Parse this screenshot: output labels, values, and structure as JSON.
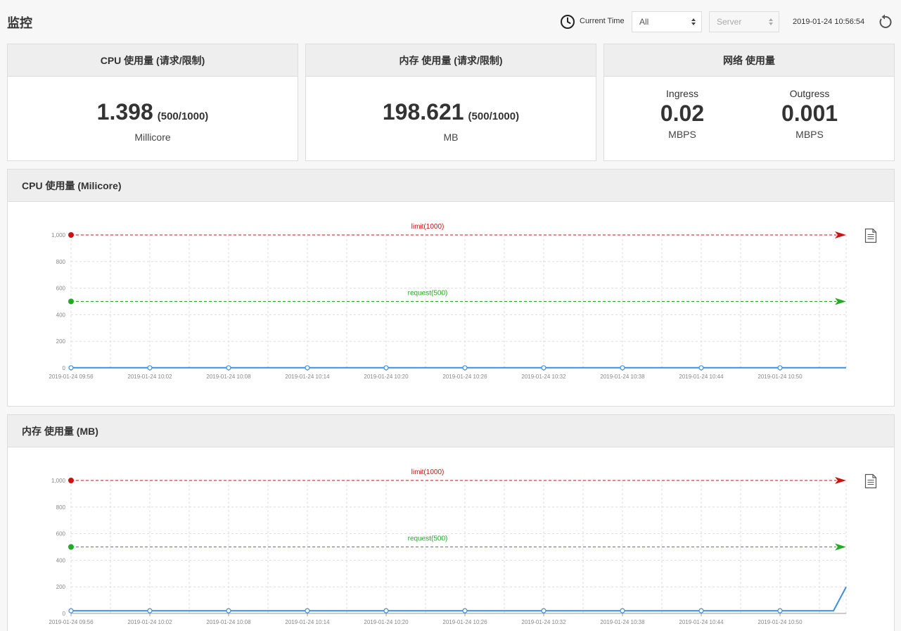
{
  "header": {
    "title": "监控",
    "time_label": "Current Time",
    "range_select": "All",
    "server_select": "Server",
    "timestamp": "2019-01-24 10:56:54"
  },
  "stats": {
    "cpu": {
      "title": "CPU 使用量 (请求/限制)",
      "value": "1.398",
      "ratio": "(500/1000)",
      "unit": "Millicore"
    },
    "memory": {
      "title": "内存 使用量 (请求/限制)",
      "value": "198.621",
      "ratio": "(500/1000)",
      "unit": "MB"
    },
    "network": {
      "title": "网络 使用量",
      "ingress": {
        "label": "Ingress",
        "value": "0.02",
        "unit": "MBPS"
      },
      "outgress": {
        "label": "Outgress",
        "value": "0.001",
        "unit": "MBPS"
      }
    }
  },
  "colors": {
    "limit": "#cc1111",
    "request": "#22aa22",
    "series": "#3a8ee6"
  },
  "chart_data": [
    {
      "type": "line",
      "title": "CPU 使用量 (Milicore)",
      "x": [
        "2019-01-24 09:56",
        "2019-01-24 10:02",
        "2019-01-24 10:08",
        "2019-01-24 10:14",
        "2019-01-24 10:20",
        "2019-01-24 10:26",
        "2019-01-24 10:32",
        "2019-01-24 10:38",
        "2019-01-24 10:44",
        "2019-01-24 10:50"
      ],
      "xticks": [
        "2019-01-24 09:56",
        "2019-01-24 10:02",
        "2019-01-24 10:08",
        "2019-01-24 10:14",
        "2019-01-24 10:20",
        "2019-01-24 10:26",
        "2019-01-24 10:32",
        "2019-01-24 10:38",
        "2019-01-24 10:44",
        "2019-01-24 10:50"
      ],
      "series": [
        {
          "values": [
            1,
            1,
            1,
            1,
            1,
            1,
            1,
            1,
            1,
            1
          ],
          "tail": [
            1,
            1
          ]
        }
      ],
      "ylim": [
        0,
        1000
      ],
      "yticks": [
        0,
        200,
        400,
        600,
        800,
        1000
      ],
      "ytick_labels": [
        "0",
        "200",
        "400",
        "600",
        "800",
        "1,000"
      ],
      "thresholds": [
        {
          "label": "limit(1000)",
          "value": 1000,
          "kind": "limit"
        },
        {
          "label": "request(500)",
          "value": 500,
          "kind": "request"
        }
      ],
      "grid": true
    },
    {
      "type": "line",
      "title": "内存 使用量 (MB)",
      "x": [
        "2019-01-24 09:56",
        "2019-01-24 10:02",
        "2019-01-24 10:08",
        "2019-01-24 10:14",
        "2019-01-24 10:20",
        "2019-01-24 10:26",
        "2019-01-24 10:32",
        "2019-01-24 10:38",
        "2019-01-24 10:44",
        "2019-01-24 10:50"
      ],
      "xticks": [
        "2019-01-24 09:56",
        "2019-01-24 10:02",
        "2019-01-24 10:08",
        "2019-01-24 10:14",
        "2019-01-24 10:20",
        "2019-01-24 10:26",
        "2019-01-24 10:32",
        "2019-01-24 10:38",
        "2019-01-24 10:44",
        "2019-01-24 10:50"
      ],
      "series": [
        {
          "values": [
            20,
            20,
            20,
            20,
            20,
            20,
            20,
            20,
            20,
            20
          ],
          "tail": [
            20,
            199
          ]
        }
      ],
      "ylim": [
        0,
        1000
      ],
      "yticks": [
        0,
        200,
        400,
        600,
        800,
        1000
      ],
      "ytick_labels": [
        "0",
        "200",
        "400",
        "600",
        "800",
        "1,000"
      ],
      "thresholds": [
        {
          "label": "limit(1000)",
          "value": 1000,
          "kind": "limit"
        },
        {
          "label": "request(500)",
          "value": 500,
          "kind": "request"
        }
      ],
      "grid": true
    }
  ]
}
